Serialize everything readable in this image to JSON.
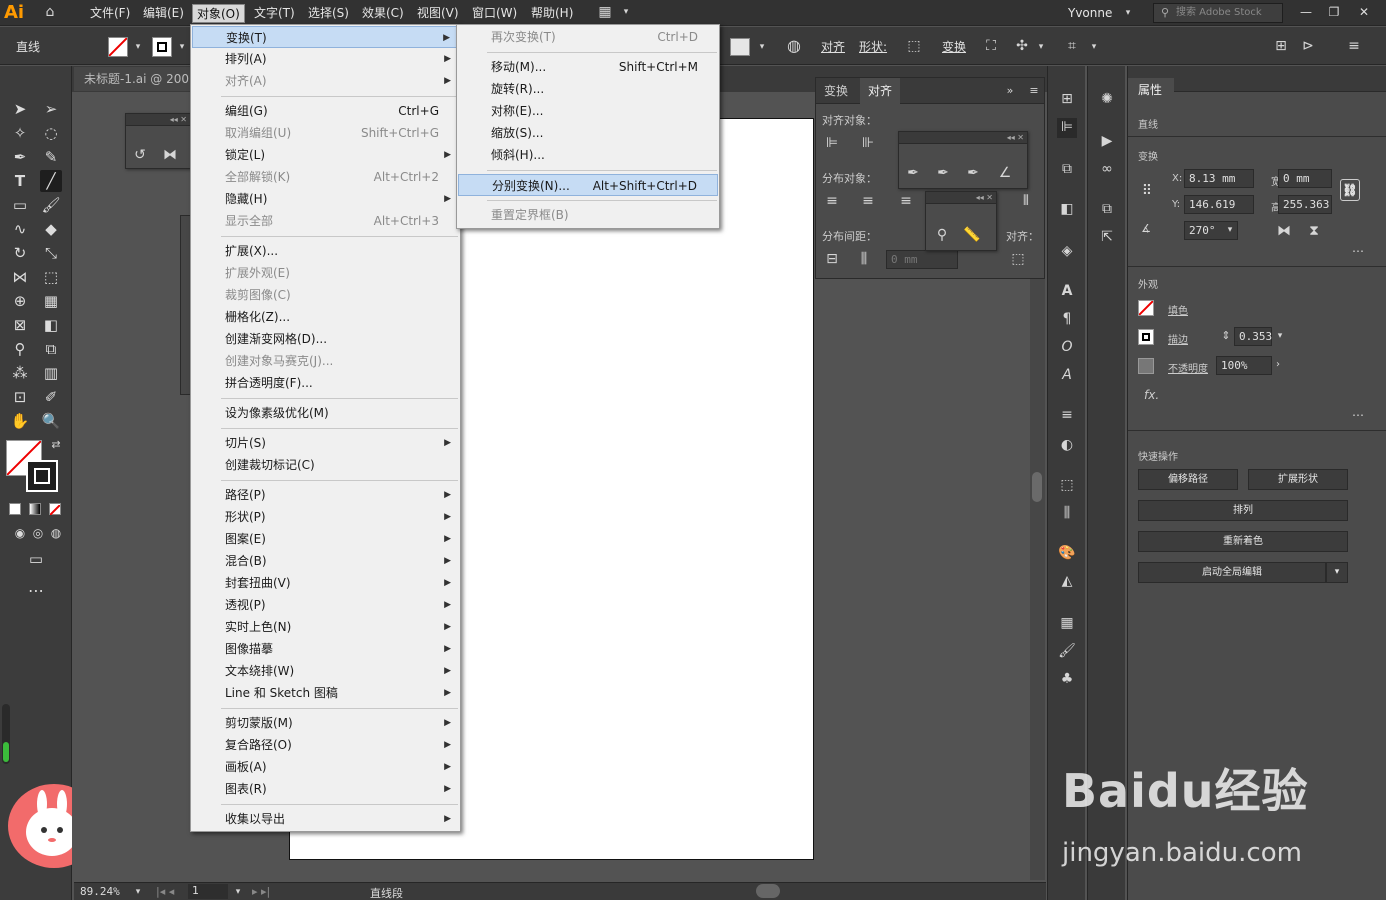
{
  "app": {
    "logo": "Ai"
  },
  "menubar": {
    "items": [
      "文件(F)",
      "编辑(E)",
      "对象(O)",
      "文字(T)",
      "选择(S)",
      "效果(C)",
      "视图(V)",
      "窗口(W)",
      "帮助(H)"
    ],
    "user": "Yvonne",
    "search_placeholder": "搜索 Adobe Stock"
  },
  "control": {
    "tool_label": "直线",
    "align_label": "对齐",
    "shape_label": "形状:",
    "transform_label": "变换"
  },
  "document": {
    "tab_title": "未标题-1.ai @ 200"
  },
  "align_panel": {
    "tabs": [
      "变换",
      "对齐"
    ],
    "align_objects": "对齐对象：",
    "distribute_objects": "分布对象：",
    "distribute_spacing": "分布间距：",
    "align_to": "对齐：",
    "spacing_value": "0 mm"
  },
  "object_menu": {
    "items": [
      {
        "label": "变换(T)",
        "shortcut": "",
        "submenu": true,
        "disabled": false,
        "highlight": true
      },
      {
        "label": "排列(A)",
        "shortcut": "",
        "submenu": true,
        "disabled": false
      },
      {
        "label": "对齐(A)",
        "shortcut": "",
        "submenu": true,
        "disabled": true
      },
      {
        "label": "编组(G)",
        "shortcut": "Ctrl+G",
        "submenu": false,
        "disabled": false
      },
      {
        "label": "取消编组(U)",
        "shortcut": "Shift+Ctrl+G",
        "submenu": false,
        "disabled": true
      },
      {
        "label": "锁定(L)",
        "shortcut": "",
        "submenu": true,
        "disabled": false
      },
      {
        "label": "全部解锁(K)",
        "shortcut": "Alt+Ctrl+2",
        "submenu": false,
        "disabled": true
      },
      {
        "label": "隐藏(H)",
        "shortcut": "",
        "submenu": true,
        "disabled": false
      },
      {
        "label": "显示全部",
        "shortcut": "Alt+Ctrl+3",
        "submenu": false,
        "disabled": true
      },
      {
        "label": "扩展(X)...",
        "shortcut": "",
        "submenu": false,
        "disabled": false
      },
      {
        "label": "扩展外观(E)",
        "shortcut": "",
        "submenu": false,
        "disabled": true
      },
      {
        "label": "裁剪图像(C)",
        "shortcut": "",
        "submenu": false,
        "disabled": true
      },
      {
        "label": "栅格化(Z)...",
        "shortcut": "",
        "submenu": false,
        "disabled": false
      },
      {
        "label": "创建渐变网格(D)...",
        "shortcut": "",
        "submenu": false,
        "disabled": false
      },
      {
        "label": "创建对象马赛克(J)...",
        "shortcut": "",
        "submenu": false,
        "disabled": true
      },
      {
        "label": "拼合透明度(F)...",
        "shortcut": "",
        "submenu": false,
        "disabled": false
      },
      {
        "label": "设为像素级优化(M)",
        "shortcut": "",
        "submenu": false,
        "disabled": false
      },
      {
        "label": "切片(S)",
        "shortcut": "",
        "submenu": true,
        "disabled": false
      },
      {
        "label": "创建裁切标记(C)",
        "shortcut": "",
        "submenu": false,
        "disabled": false
      },
      {
        "label": "路径(P)",
        "shortcut": "",
        "submenu": true,
        "disabled": false
      },
      {
        "label": "形状(P)",
        "shortcut": "",
        "submenu": true,
        "disabled": false
      },
      {
        "label": "图案(E)",
        "shortcut": "",
        "submenu": true,
        "disabled": false
      },
      {
        "label": "混合(B)",
        "shortcut": "",
        "submenu": true,
        "disabled": false
      },
      {
        "label": "封套扭曲(V)",
        "shortcut": "",
        "submenu": true,
        "disabled": false
      },
      {
        "label": "透视(P)",
        "shortcut": "",
        "submenu": true,
        "disabled": false
      },
      {
        "label": "实时上色(N)",
        "shortcut": "",
        "submenu": true,
        "disabled": false
      },
      {
        "label": "图像描摹",
        "shortcut": "",
        "submenu": true,
        "disabled": false
      },
      {
        "label": "文本绕排(W)",
        "shortcut": "",
        "submenu": true,
        "disabled": false
      },
      {
        "label": "Line 和 Sketch 图稿",
        "shortcut": "",
        "submenu": true,
        "disabled": false
      },
      {
        "label": "剪切蒙版(M)",
        "shortcut": "",
        "submenu": true,
        "disabled": false
      },
      {
        "label": "复合路径(O)",
        "shortcut": "",
        "submenu": true,
        "disabled": false
      },
      {
        "label": "画板(A)",
        "shortcut": "",
        "submenu": true,
        "disabled": false
      },
      {
        "label": "图表(R)",
        "shortcut": "",
        "submenu": true,
        "disabled": false
      },
      {
        "label": "收集以导出",
        "shortcut": "",
        "submenu": true,
        "disabled": false
      }
    ]
  },
  "transform_submenu": {
    "items": [
      {
        "label": "再次变换(T)",
        "shortcut": "Ctrl+D",
        "disabled": true
      },
      {
        "label": "移动(M)...",
        "shortcut": "Shift+Ctrl+M",
        "disabled": false
      },
      {
        "label": "旋转(R)...",
        "shortcut": "",
        "disabled": false
      },
      {
        "label": "对称(E)...",
        "shortcut": "",
        "disabled": false
      },
      {
        "label": "缩放(S)...",
        "shortcut": "",
        "disabled": false
      },
      {
        "label": "倾斜(H)...",
        "shortcut": "",
        "disabled": false
      },
      {
        "label": "分别变换(N)...",
        "shortcut": "Alt+Shift+Ctrl+D",
        "disabled": false,
        "highlight": true
      },
      {
        "label": "重置定界框(B)",
        "shortcut": "",
        "disabled": true
      }
    ]
  },
  "properties": {
    "tab": "属性",
    "object_type": "直线",
    "transform_title": "变换",
    "x_label": "X:",
    "x_value": "8.13 mm",
    "y_label": "Y:",
    "y_value": "146.619",
    "w_label": "宽:",
    "w_value": "0 mm",
    "h_label": "高:",
    "h_value": "255.363",
    "angle_value": "270°",
    "appearance_title": "外观",
    "fill_label": "填色",
    "stroke_label": "描边",
    "stroke_value": "0.353",
    "opacity_label": "不透明度",
    "opacity_value": "100%",
    "fx_label": "fx.",
    "quick_actions_title": "快速操作",
    "btn_offset_path": "偏移路径",
    "btn_expand_shape": "扩展形状",
    "btn_arrange": "排列",
    "btn_recolor": "重新着色",
    "btn_global_edit": "启动全局编辑"
  },
  "status": {
    "zoom": "89.24%",
    "page": "1",
    "tool_status": "直线段"
  },
  "watermark": {
    "line1": "Baidu经验",
    "line2": "jingyan.baidu.com"
  }
}
